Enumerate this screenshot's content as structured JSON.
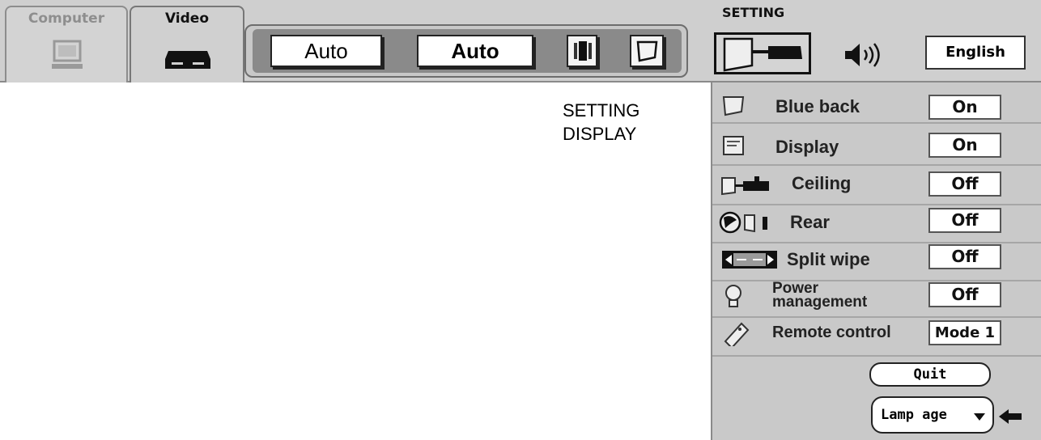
{
  "tabs": [
    {
      "label": "Computer",
      "icon": "computer-monitor-icon",
      "active": false
    },
    {
      "label": "Video",
      "icon": "vcr-icon",
      "active": true
    }
  ],
  "toolbar": {
    "buttons": [
      {
        "label": "Auto"
      },
      {
        "label": "Auto"
      }
    ],
    "icons": [
      "image-adjust-icon",
      "screen-icon"
    ]
  },
  "setting": {
    "title": "SETTING",
    "language": "English",
    "icons": [
      "projector-icon",
      "speaker-icon"
    ]
  },
  "side_label": {
    "line1": "SETTING",
    "line2": "DISPLAY"
  },
  "menu": {
    "items": [
      {
        "icon": "blue-screen-icon",
        "label": "Blue back",
        "value": "On"
      },
      {
        "icon": "display-icon",
        "label": "Display",
        "value": "On"
      },
      {
        "icon": "ceiling-projector-icon",
        "label": "Ceiling",
        "value": "Off"
      },
      {
        "icon": "rear-projection-icon",
        "label": "Rear",
        "value": "Off"
      },
      {
        "icon": "split-wipe-icon",
        "label": "Split wipe",
        "value": "Off"
      },
      {
        "icon": "lamp-bulb-icon",
        "label_line1": "Power",
        "label_line2": "management",
        "value": "Off"
      },
      {
        "icon": "remote-control-icon",
        "label": "Remote control",
        "value": "Mode 1"
      }
    ],
    "quit_label": "Quit",
    "lamp_label": "Lamp age"
  },
  "colors": {
    "panel": "#c9c9c9",
    "topbar": "#cfcfcf",
    "button_face": "#ffffff",
    "text": "#111111"
  }
}
